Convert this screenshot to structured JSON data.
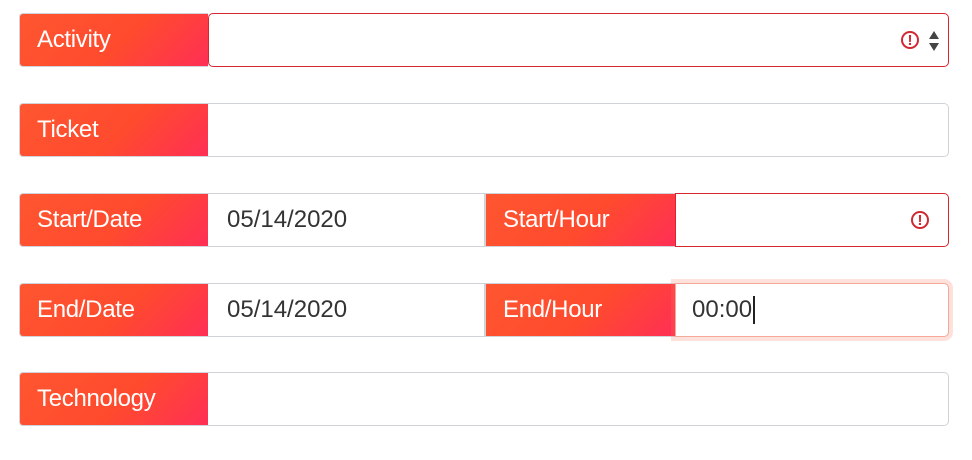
{
  "form": {
    "activity": {
      "label": "Activity",
      "value": "",
      "invalid": true
    },
    "ticket": {
      "label": "Ticket",
      "value": ""
    },
    "start_date": {
      "label": "Start/Date",
      "value": "05/14/2020"
    },
    "start_hour": {
      "label": "Start/Hour",
      "value": "",
      "invalid": true
    },
    "end_date": {
      "label": "End/Date",
      "value": "05/14/2020"
    },
    "end_hour": {
      "label": "End/Hour",
      "value": "00:00",
      "focused": true
    },
    "technology": {
      "label": "Technology",
      "value": ""
    }
  },
  "icons": {
    "error": "exclamation-circle-icon",
    "select": "sort-arrows-icon"
  },
  "colors": {
    "label_gradient": [
      "#ff5630",
      "#ff2f55"
    ],
    "error": "#d8262f",
    "focus_glow": "#f3a899"
  }
}
